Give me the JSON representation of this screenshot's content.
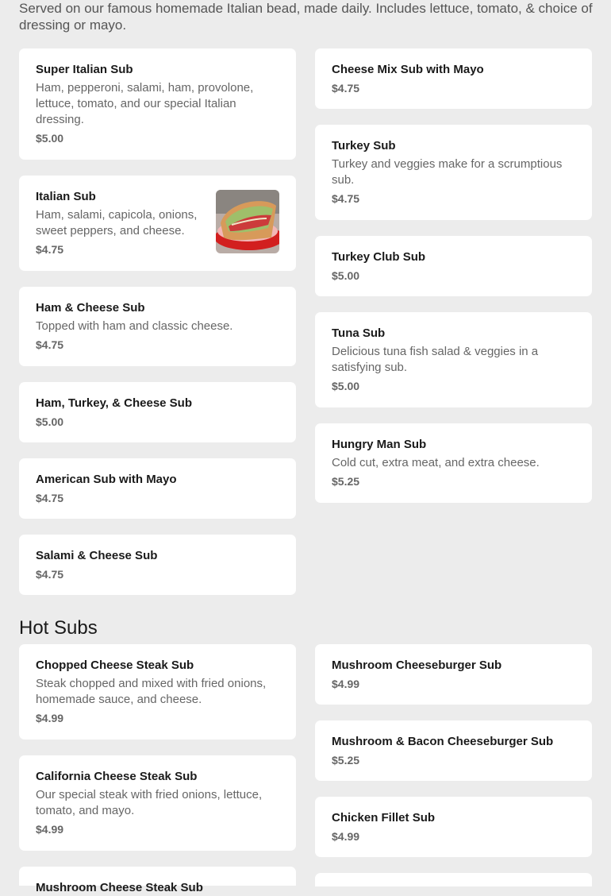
{
  "intro_text": "Served on our famous homemade Italian bead, made daily. Includes lettuce, tomato, & choice of dressing or mayo.",
  "cold_subs": {
    "left": [
      {
        "name": "Super Italian Sub",
        "desc": "Ham, pepperoni, salami, ham, provolone, lettuce, tomato, and our special Italian dressing.",
        "price": "$5.00"
      },
      {
        "name": "Italian Sub",
        "desc": "Ham, salami, capicola, onions, sweet peppers, and cheese.",
        "price": "$4.75",
        "image": "italian-sub-photo"
      },
      {
        "name": "Ham & Cheese Sub",
        "desc": "Topped with ham and classic cheese.",
        "price": "$4.75"
      },
      {
        "name": "Ham, Turkey, & Cheese Sub",
        "price": "$5.00"
      },
      {
        "name": "American Sub with Mayo",
        "price": "$4.75"
      },
      {
        "name": "Salami & Cheese Sub",
        "price": "$4.75"
      }
    ],
    "right": [
      {
        "name": "Cheese Mix Sub with Mayo",
        "price": "$4.75"
      },
      {
        "name": "Turkey Sub",
        "desc": "Turkey and veggies make for a scrumptious sub.",
        "price": "$4.75"
      },
      {
        "name": "Turkey Club Sub",
        "price": "$5.00"
      },
      {
        "name": "Tuna Sub",
        "desc": "Delicious tuna fish salad & veggies in a satisfying sub.",
        "price": "$5.00"
      },
      {
        "name": "Hungry Man Sub",
        "desc": "Cold cut, extra meat, and extra cheese.",
        "price": "$5.25"
      }
    ]
  },
  "hot_subs": {
    "title": "Hot Subs",
    "left": [
      {
        "name": "Chopped Cheese Steak Sub",
        "desc": "Steak chopped and mixed with fried onions, homemade sauce, and cheese.",
        "price": "$4.99"
      },
      {
        "name": "California Cheese Steak Sub",
        "desc": "Our special steak with fried onions, lettuce, tomato, and mayo.",
        "price": "$4.99"
      },
      {
        "name": "Mushroom Cheese Steak Sub"
      }
    ],
    "right": [
      {
        "name": "Mushroom Cheeseburger Sub",
        "price": "$4.99"
      },
      {
        "name": "Mushroom & Bacon Cheeseburger Sub",
        "price": "$5.25"
      },
      {
        "name": "Chicken Fillet Sub",
        "price": "$4.99"
      },
      {
        "name": ""
      }
    ]
  },
  "colors": {
    "background": "#ececec",
    "card": "#ffffff",
    "heading": "#1a1a1a",
    "muted": "#666666"
  }
}
